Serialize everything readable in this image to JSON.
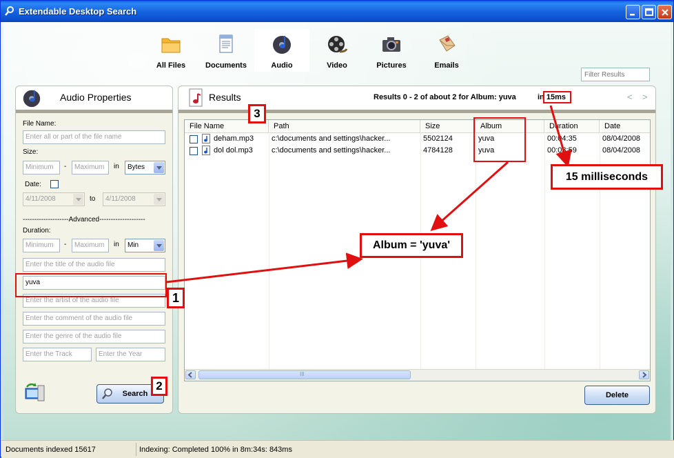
{
  "window": {
    "title": "Extendable Desktop Search"
  },
  "categories": [
    {
      "label": "All Files",
      "icon": "folder-icon"
    },
    {
      "label": "Documents",
      "icon": "document-icon"
    },
    {
      "label": "Audio",
      "icon": "music-note-icon",
      "active": true
    },
    {
      "label": "Video",
      "icon": "film-reel-icon"
    },
    {
      "label": "Pictures",
      "icon": "camera-icon"
    },
    {
      "label": "Emails",
      "icon": "envelope-icon"
    }
  ],
  "filter": {
    "placeholder": "Filter Results"
  },
  "left_panel": {
    "title": "Audio Properties",
    "file_name_label": "File Name:",
    "file_name_placeholder": "Enter all or part of the file name",
    "size_label": "Size:",
    "min_placeholder": "Minimum",
    "max_placeholder": "Maximum",
    "dash": "-",
    "in_label": "in",
    "size_unit": "Bytes",
    "date_label": "Date:",
    "date_from": "4/11/2008",
    "date_to_label": "to",
    "date_to": "4/11/2008",
    "advanced_label": "--------------------Advanced--------------------",
    "duration_label": "Duration:",
    "dur_min_placeholder": "Minimum",
    "dur_max_placeholder": "Maximum",
    "duration_unit": "Min",
    "title_placeholder": "Enter the title of the audio file",
    "album_value": "yuva",
    "artist_placeholder": "Enter the artist of the audio file",
    "comment_placeholder": "Enter the comment of the audio file",
    "genre_placeholder": "Enter the genre of the audio file",
    "track_placeholder": "Enter the Track",
    "year_placeholder": "Enter the Year",
    "search_label": "Search"
  },
  "results": {
    "title": "Results",
    "summary": "Results 0 - 2  of about 2 for Album: yuva",
    "time_prefix": "in",
    "time": "15ms",
    "prev": "<",
    "next": ">",
    "columns": [
      "File Name",
      "Path",
      "Size",
      "Album",
      "Duration",
      "Date"
    ],
    "rows": [
      {
        "name": "deham.mp3",
        "path": "c:\\documents and settings\\hacker...",
        "size": "5502124",
        "album": "yuva",
        "duration": "00:04:35",
        "date": "08/04/2008"
      },
      {
        "name": "dol dol.mp3",
        "path": "c:\\documents and settings\\hacker...",
        "size": "4784128",
        "album": "yuva",
        "duration": "00:03:59",
        "date": "08/04/2008"
      }
    ],
    "scroll_grip": "III",
    "delete_label": "Delete"
  },
  "annotations": {
    "n1": "1",
    "n2": "2",
    "n3": "3",
    "album_callout": "Album = 'yuva'",
    "ms_callout": "15 milliseconds"
  },
  "status": {
    "indexed": "Documents indexed 15617",
    "indexing": "Indexing: Completed 100% in 8m:34s: 843ms"
  },
  "colors": {
    "annotation_red": "#e01010",
    "titlebar_blue": "#0c4fcf"
  }
}
